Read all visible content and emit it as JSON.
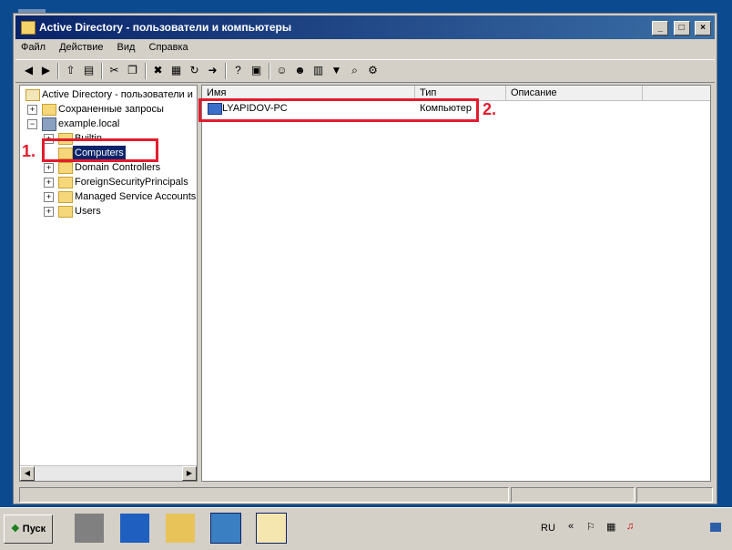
{
  "window": {
    "title": "Active Directory - пользователи и компьютеры",
    "buttons": [
      "_",
      "□",
      "×"
    ]
  },
  "menu": [
    "Файл",
    "Действие",
    "Вид",
    "Справка"
  ],
  "toolbar": [
    "back-icon",
    "forward-icon",
    "up-folder-icon",
    "show-hide-tree-icon",
    "cut-icon",
    "copy-icon",
    "delete-icon",
    "properties-icon",
    "refresh-icon",
    "export-icon",
    "help-icon",
    "console-icon",
    "add-user-icon",
    "add-group-icon",
    "add-ou-icon",
    "filter-icon",
    "find-icon",
    "add-to-group-icon"
  ],
  "tree": {
    "root": "Active Directory - пользователи и",
    "saved_queries": "Сохраненные запросы",
    "domain": "example.local",
    "children": [
      "Builtin",
      "Computers",
      "Domain Controllers",
      "ForeignSecurityPrincipals",
      "Managed Service Accounts",
      "Users"
    ]
  },
  "list": {
    "columns": [
      "Имя",
      "Тип",
      "Описание"
    ],
    "rows": [
      {
        "name": "LYAPIDOV-PC",
        "type": "Компьютер",
        "description": ""
      }
    ]
  },
  "annotations": {
    "label1": "1.",
    "label2": "2.",
    "color": "#e41b2d"
  },
  "taskbar": {
    "start": "Пуск",
    "language": "RU"
  }
}
